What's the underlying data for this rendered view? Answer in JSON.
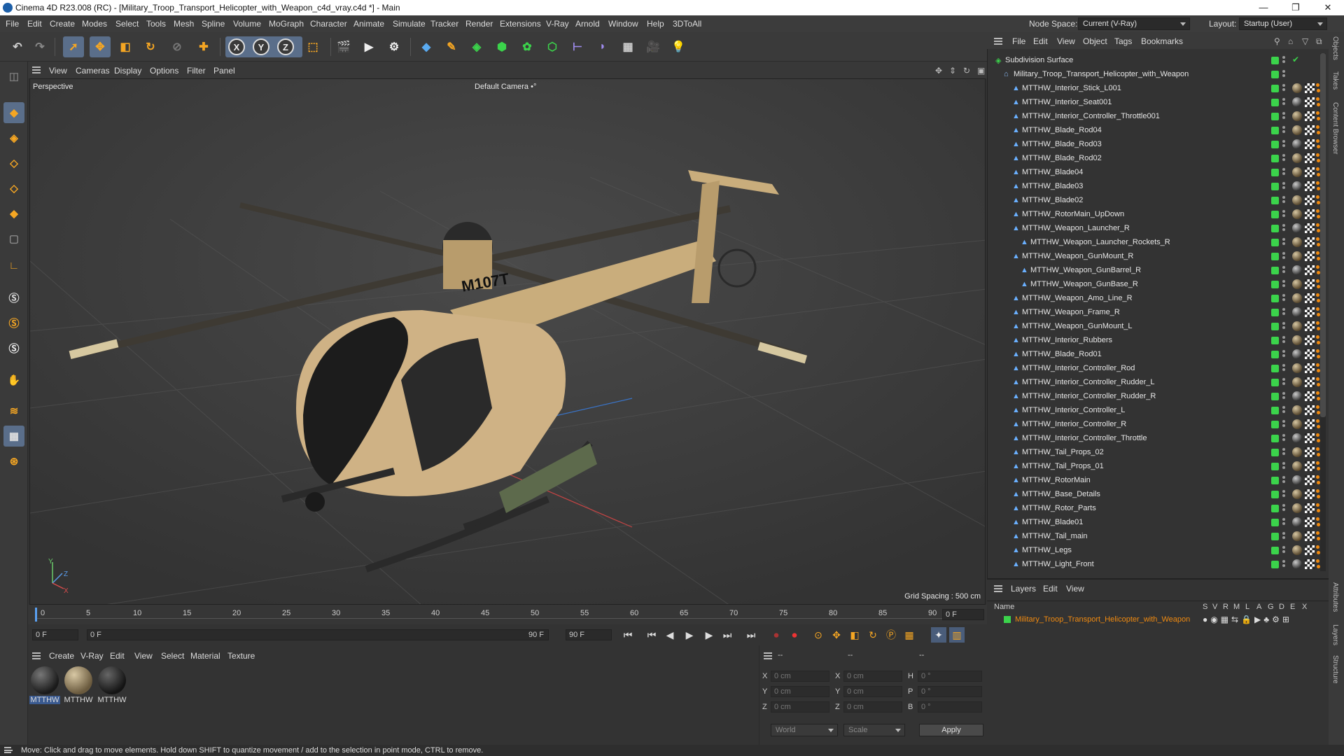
{
  "window": {
    "title": "Cinema 4D R23.008 (RC) - [Military_Troop_Transport_Helicopter_with_Weapon_c4d_vray.c4d *] - Main",
    "minimize": "—",
    "maximize": "❐",
    "close": "✕"
  },
  "menubar": {
    "items": [
      "File",
      "Edit",
      "Create",
      "Modes",
      "Select",
      "Tools",
      "Mesh",
      "Spline",
      "Volume",
      "MoGraph",
      "Character",
      "Animate",
      "Simulate",
      "Tracker",
      "Render",
      "Extensions",
      "V-Ray",
      "Arnold",
      "Window",
      "Help",
      "3DToAll"
    ],
    "node_space_label": "Node Space:",
    "node_space_value": "Current (V-Ray)",
    "layout_label": "Layout:",
    "layout_value": "Startup (User)"
  },
  "toolbar": {
    "axis_x": "X",
    "axis_y": "Y",
    "axis_z": "Z"
  },
  "viewport": {
    "menu": [
      "View",
      "Cameras",
      "Display",
      "Options",
      "Filter",
      "Panel"
    ],
    "view_name": "Perspective",
    "camera": "Default Camera",
    "camera_suffix": "•°",
    "grid_spacing": "Grid Spacing : 500 cm",
    "decal_text": "M107T",
    "axis_y": "Y",
    "axis_z": "Z",
    "axis_x": "X"
  },
  "timeline": {
    "ticks": [
      "0",
      "5",
      "10",
      "15",
      "20",
      "25",
      "30",
      "35",
      "40",
      "45",
      "50",
      "55",
      "60",
      "65",
      "70",
      "75",
      "80",
      "85",
      "90"
    ],
    "current_frame": "0 F",
    "start_frame": "0 F",
    "range_start": "0 F",
    "range_end": "90 F",
    "end_frame": "90 F"
  },
  "material_manager": {
    "menu": [
      "Create",
      "V-Ray",
      "Edit",
      "View",
      "Select",
      "Material",
      "Texture"
    ],
    "materials": [
      {
        "label": "MTTHW",
        "color": "#222"
      },
      {
        "label": "MTTHW",
        "color": "#8a7a5e"
      },
      {
        "label": "MTTHW",
        "color": "#1e1e1e"
      }
    ]
  },
  "coordinates": {
    "headers": [
      "--",
      "--",
      "--"
    ],
    "rows": [
      {
        "a": "X",
        "av": "0 cm",
        "b": "X",
        "bv": "0 cm",
        "c": "H",
        "cv": "0 °"
      },
      {
        "a": "Y",
        "av": "0 cm",
        "b": "Y",
        "bv": "0 cm",
        "c": "P",
        "cv": "0 °"
      },
      {
        "a": "Z",
        "av": "0 cm",
        "b": "Z",
        "bv": "0 cm",
        "c": "B",
        "cv": "0 °"
      }
    ],
    "mode": "World",
    "scale": "Scale",
    "apply": "Apply"
  },
  "object_manager": {
    "menu": [
      "File",
      "Edit",
      "View",
      "Object",
      "Tags",
      "Bookmarks"
    ],
    "objects": [
      {
        "name": "Subdivision Surface",
        "indent": 0,
        "type": "sub"
      },
      {
        "name": "Military_Troop_Transport_Helicopter_with_Weapon",
        "indent": 1,
        "type": "null"
      },
      {
        "name": "MTTHW_Interior_Stick_L001",
        "indent": 2,
        "type": "poly"
      },
      {
        "name": "MTTHW_Interior_Seat001",
        "indent": 2,
        "type": "poly"
      },
      {
        "name": "MTTHW_Interior_Controller_Throttle001",
        "indent": 2,
        "type": "poly"
      },
      {
        "name": "MTTHW_Blade_Rod04",
        "indent": 2,
        "type": "poly"
      },
      {
        "name": "MTTHW_Blade_Rod03",
        "indent": 2,
        "type": "poly"
      },
      {
        "name": "MTTHW_Blade_Rod02",
        "indent": 2,
        "type": "poly"
      },
      {
        "name": "MTTHW_Blade04",
        "indent": 2,
        "type": "poly"
      },
      {
        "name": "MTTHW_Blade03",
        "indent": 2,
        "type": "poly"
      },
      {
        "name": "MTTHW_Blade02",
        "indent": 2,
        "type": "poly"
      },
      {
        "name": "MTTHW_RotorMain_UpDown",
        "indent": 2,
        "type": "poly"
      },
      {
        "name": "MTTHW_Weapon_Launcher_R",
        "indent": 2,
        "type": "poly"
      },
      {
        "name": "MTTHW_Weapon_Launcher_Rockets_R",
        "indent": 3,
        "type": "poly"
      },
      {
        "name": "MTTHW_Weapon_GunMount_R",
        "indent": 2,
        "type": "poly"
      },
      {
        "name": "MTTHW_Weapon_GunBarrel_R",
        "indent": 3,
        "type": "poly"
      },
      {
        "name": "MTTHW_Weapon_GunBase_R",
        "indent": 3,
        "type": "poly"
      },
      {
        "name": "MTTHW_Weapon_Amo_Line_R",
        "indent": 2,
        "type": "poly"
      },
      {
        "name": "MTTHW_Weapon_Frame_R",
        "indent": 2,
        "type": "poly"
      },
      {
        "name": "MTTHW_Weapon_GunMount_L",
        "indent": 2,
        "type": "poly"
      },
      {
        "name": "MTTHW_Interior_Rubbers",
        "indent": 2,
        "type": "poly"
      },
      {
        "name": "MTTHW_Blade_Rod01",
        "indent": 2,
        "type": "poly"
      },
      {
        "name": "MTTHW_Interior_Controller_Rod",
        "indent": 2,
        "type": "poly"
      },
      {
        "name": "MTTHW_Interior_Controller_Rudder_L",
        "indent": 2,
        "type": "poly"
      },
      {
        "name": "MTTHW_Interior_Controller_Rudder_R",
        "indent": 2,
        "type": "poly"
      },
      {
        "name": "MTTHW_Interior_Controller_L",
        "indent": 2,
        "type": "poly"
      },
      {
        "name": "MTTHW_Interior_Controller_R",
        "indent": 2,
        "type": "poly"
      },
      {
        "name": "MTTHW_Interior_Controller_Throttle",
        "indent": 2,
        "type": "poly"
      },
      {
        "name": "MTTHW_Tail_Props_02",
        "indent": 2,
        "type": "poly"
      },
      {
        "name": "MTTHW_Tail_Props_01",
        "indent": 2,
        "type": "poly"
      },
      {
        "name": "MTTHW_RotorMain",
        "indent": 2,
        "type": "poly"
      },
      {
        "name": "MTTHW_Base_Details",
        "indent": 2,
        "type": "poly"
      },
      {
        "name": "MTTHW_Rotor_Parts",
        "indent": 2,
        "type": "poly"
      },
      {
        "name": "MTTHW_Blade01",
        "indent": 2,
        "type": "poly"
      },
      {
        "name": "MTTHW_Tail_main",
        "indent": 2,
        "type": "poly"
      },
      {
        "name": "MTTHW_Legs",
        "indent": 2,
        "type": "poly"
      },
      {
        "name": "MTTHW_Light_Front",
        "indent": 2,
        "type": "poly"
      }
    ]
  },
  "layer_manager": {
    "menu": [
      "Layers",
      "Edit",
      "View"
    ],
    "col_name": "Name",
    "cols": [
      "S",
      "V",
      "R",
      "M",
      "L",
      "A",
      "G",
      "D",
      "E",
      "X"
    ],
    "layer": "Military_Troop_Transport_Helicopter_with_Weapon",
    "layer_color": "#f08a10"
  },
  "side_tabs": [
    "Objects",
    "Takes",
    "Content Browser",
    "Attributes",
    "Layers",
    "Structure"
  ],
  "status": "Move: Click and drag to move elements. Hold down SHIFT to quantize movement / add to the selection in point mode, CTRL to remove."
}
